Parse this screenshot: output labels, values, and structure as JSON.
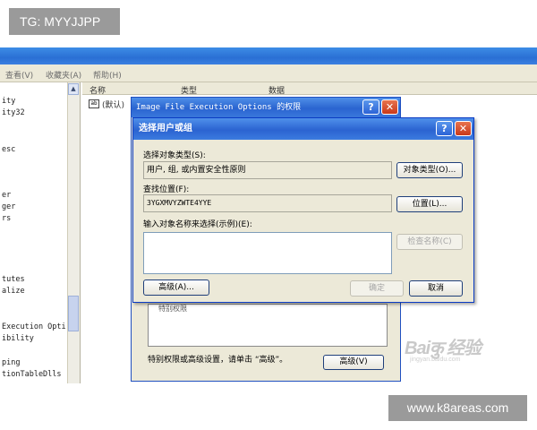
{
  "watermark_top": "TG: MYYJJPP",
  "watermark_bottom": "www.k8areas.com",
  "baidu": {
    "logo": "Baiकु 经验",
    "sub": "jingyan.baidu.com"
  },
  "menubar": {
    "items": [
      "查看(V)",
      "收藏夹(A)",
      "帮助(H)"
    ]
  },
  "tree": {
    "items": [
      "ity",
      "ity32",
      "esc",
      "er",
      "ger",
      "rs",
      "tutes",
      "alize",
      "Execution Opti",
      "ibility",
      "ping",
      "tionTableDlls"
    ],
    "scroll_up": "▲"
  },
  "list": {
    "columns": [
      "名称",
      "类型",
      "数据"
    ],
    "row_icon": "ab",
    "row_text": "(默认)"
  },
  "perm_dialog": {
    "title": "Image File Execution Options 的权限",
    "panel_text": "特别权限",
    "note": "特别权限或高级设置，请单击 “高级”。",
    "advanced_button": "高级(V)"
  },
  "select_dialog": {
    "title": "选择用户或组",
    "object_type_label": "选择对象类型(S):",
    "object_type_value": "用户, 组, 或内置安全性原则",
    "object_type_button": "对象类型(O)...",
    "location_label": "查找位置(F):",
    "location_value": "3YGXMVYZWTE4YYE",
    "location_button": "位置(L)...",
    "names_label": "输入对象名称来选择(示例)(E):",
    "check_names_button": "检查名称(C)",
    "advanced_button": "高级(A)...",
    "ok_button": "确定",
    "cancel_button": "取消"
  },
  "controls": {
    "help": "?",
    "close": "✕"
  }
}
